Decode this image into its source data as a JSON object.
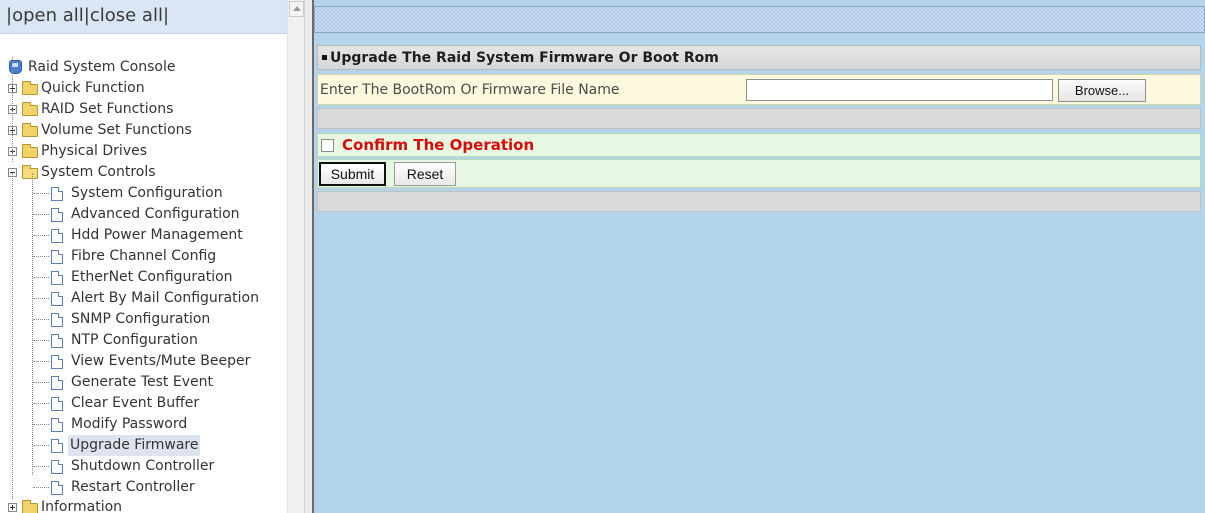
{
  "tree_header": {
    "open_all": "open all",
    "close_all": "close all",
    "sep": "|"
  },
  "tree": {
    "root": "Raid System Console",
    "quick_function": "Quick Function",
    "raid_set_functions": "RAID Set Functions",
    "volume_set_functions": "Volume Set Functions",
    "physical_drives": "Physical Drives",
    "system_controls": "System Controls",
    "system_controls_items": [
      "System Configuration",
      "Advanced Configuration",
      "Hdd Power Management",
      "Fibre Channel Config",
      "EtherNet Configuration",
      "Alert By Mail Configuration",
      "SNMP Configuration",
      "NTP Configuration",
      "View Events/Mute Beeper",
      "Generate Test Event",
      "Clear Event Buffer",
      "Modify Password",
      "Upgrade Firmware",
      "Shutdown Controller",
      "Restart Controller"
    ],
    "selected_item": "Upgrade Firmware",
    "information": "Information"
  },
  "panel": {
    "title": "Upgrade The Raid System Firmware Or Boot Rom",
    "file_label": "Enter The BootRom Or Firmware File Name",
    "file_value": "",
    "browse_label": "Browse...",
    "confirm_label": "Confirm The Operation",
    "confirm_checked": false,
    "submit_label": "Submit",
    "reset_label": "Reset"
  },
  "colors": {
    "content_background": "#b3d4ea",
    "confirm_text": "#d70b0b",
    "file_row_background": "#fcf9de",
    "confirm_row_background": "#e6f7e2"
  }
}
